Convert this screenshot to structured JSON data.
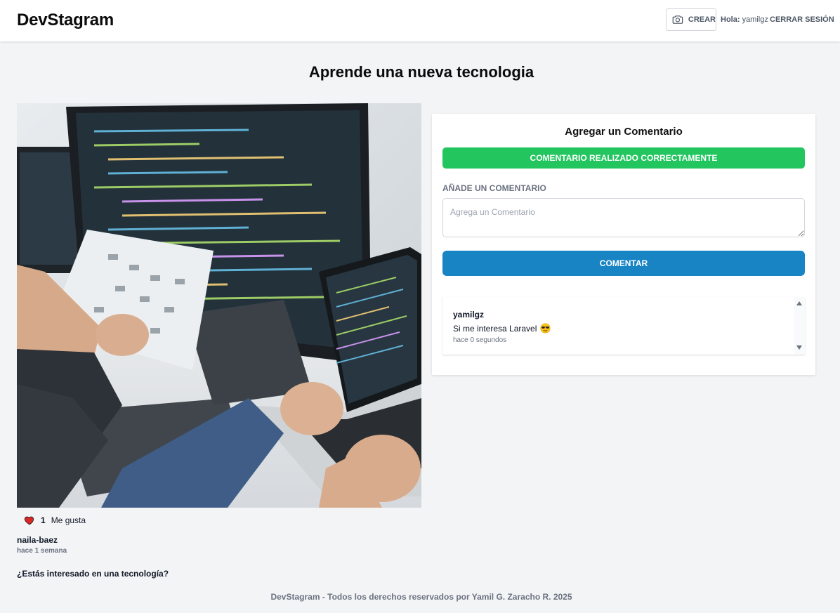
{
  "header": {
    "brand": "DevStagram",
    "create_label": "CREAR",
    "greeting_prefix": "Hola:",
    "username": "yamilgz",
    "logout_label": "CERRAR SESIÓN"
  },
  "post": {
    "title": "Aprende una nueva tecnologia",
    "image_alt": "Programadores trabajando con código en monitores",
    "likes_count": "1",
    "likes_label": "Me gusta",
    "author": "naila-baez",
    "time": "hace 1 semana",
    "description": "¿Estás interesado en una tecnología?"
  },
  "comment_form": {
    "title": "Agregar un Comentario",
    "success_message": "COMENTARIO REALIZADO CORRECTAMENTE",
    "field_label": "AÑADE UN COMENTARIO",
    "placeholder": "Agrega un Comentario",
    "submit_label": "COMENTAR"
  },
  "comments": [
    {
      "user": "yamilgz",
      "text": "Si me interesa Laravel",
      "time": "hace 0 segundos"
    }
  ],
  "footer": {
    "text": "DevStagram - Todos los derechos reservados por Yamil G. Zaracho R. 2025"
  },
  "colors": {
    "success": "#22c55e",
    "primary": "#1984c4",
    "background": "#f3f4f6",
    "heart": "#dc2626"
  }
}
